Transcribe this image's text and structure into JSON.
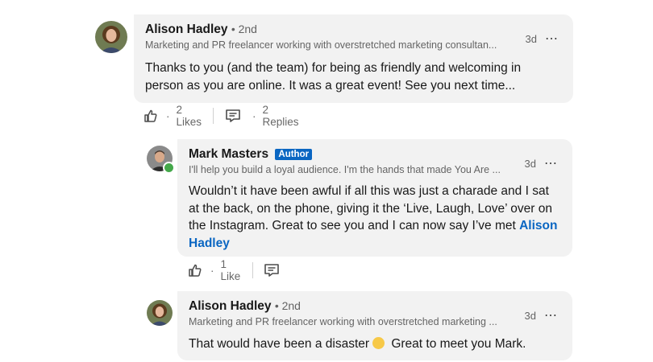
{
  "comments": [
    {
      "name": "Alison Hadley",
      "degree": "• 2nd",
      "headline": "Marketing and PR freelancer working with overstretched marketing consultan...",
      "time": "3d",
      "text": "Thanks to you (and the team) for being as friendly and welcoming in person as you are online. It was a great event! See you next time...",
      "likes": "2 Likes",
      "replies": "2 Replies"
    },
    {
      "name": "Mark Masters",
      "badge": "Author",
      "headline": "I'll help you build a loyal audience. I'm the hands that made You Are ...",
      "time": "3d",
      "text_before": "Wouldn’t it have been awful if all this was just a charade and I sat at the back, on the phone, giving it the ‘Live, Laugh, Love’ over on the Instagram. Great to see you and I can now say I’ve met ",
      "mention": "Alison Hadley",
      "likes": "1 Like"
    },
    {
      "name": "Alison Hadley",
      "degree": "• 2nd",
      "headline": "Marketing and PR freelancer working with overstretched marketing ...",
      "time": "3d",
      "text_before": "That would have been a disaster",
      "text_after": "Great to meet you Mark."
    }
  ],
  "icons": {
    "more": "⋯",
    "like": "like-icon",
    "reply": "reply-icon",
    "online": "#44a84a"
  },
  "actions": {
    "dot": "·"
  }
}
